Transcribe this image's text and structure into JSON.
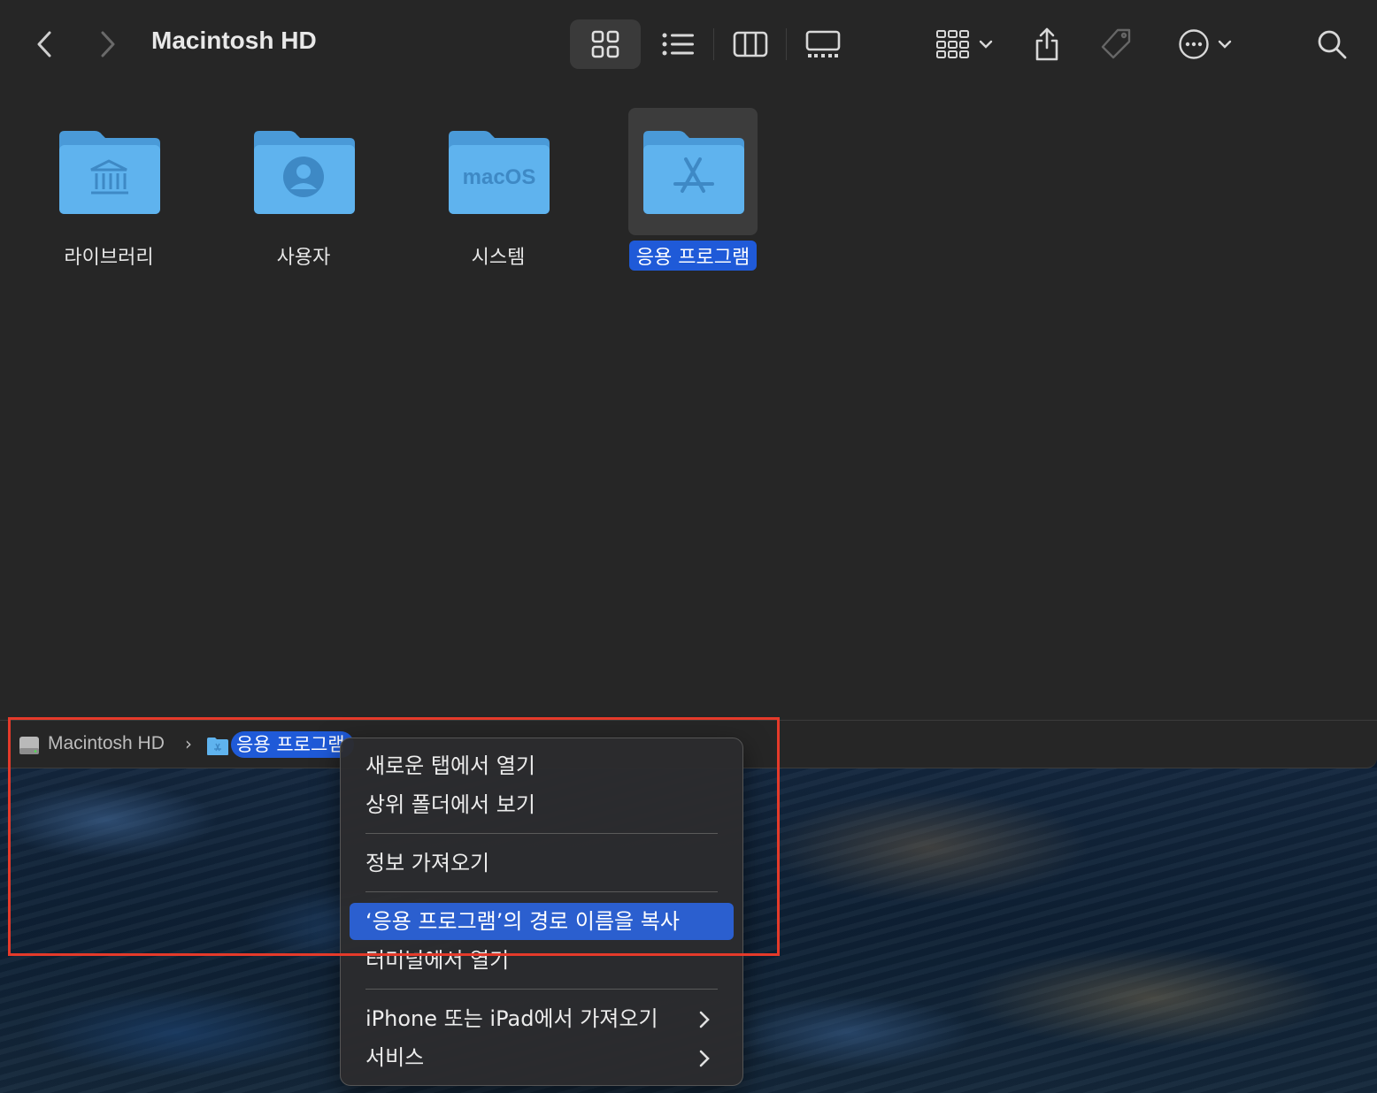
{
  "window": {
    "title": "Macintosh HD"
  },
  "items": [
    {
      "name": "라이브러리",
      "icon": "library-folder-icon"
    },
    {
      "name": "사용자",
      "icon": "users-folder-icon"
    },
    {
      "name": "시스템",
      "icon": "system-folder-icon",
      "badge": "macOS"
    },
    {
      "name": "응용 프로그램",
      "icon": "applications-folder-icon",
      "selected": true
    }
  ],
  "pathbar": {
    "root": "Macintosh HD",
    "current": "응용 프로그램"
  },
  "context_menu": {
    "items": [
      "새로운 탭에서 열기",
      "상위 폴더에서 보기",
      "정보 가져오기",
      "‘응용 프로그램’의 경로 이름을 복사",
      "터미널에서 열기",
      "iPhone 또는 iPad에서 가져오기",
      "서비스"
    ],
    "highlighted_index": 3
  },
  "colors": {
    "accent": "#1f5ad8",
    "folder": "#5fb3ee",
    "annotation": "#e53a2a"
  }
}
